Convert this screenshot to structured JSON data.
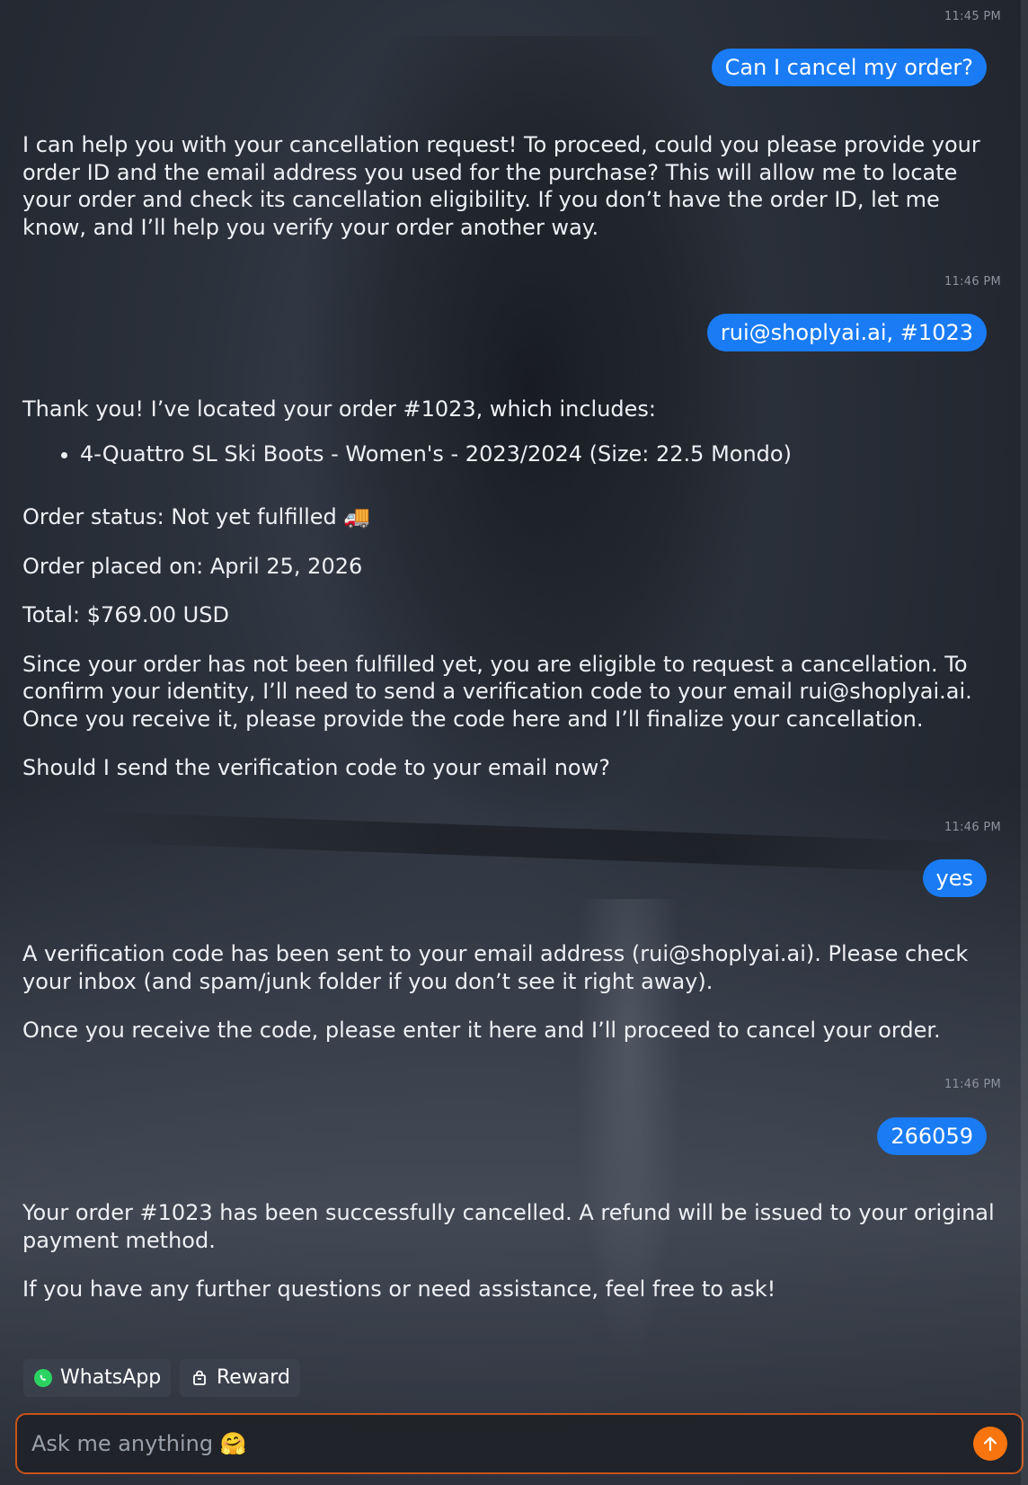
{
  "conversation": {
    "messages": [
      {
        "role": "user",
        "time": "11:45 PM",
        "text": "Can I cancel my order?"
      },
      {
        "role": "assistant",
        "paragraphs": [
          "I can help you with your cancellation request! To proceed, could you please provide your order ID and the email address you used for the purchase? This will allow me to locate your order and check its cancellation eligibility. If you don’t have the order ID, let me know, and I’ll help you verify your order another way."
        ]
      },
      {
        "role": "user",
        "time": "11:46 PM",
        "text": "rui@shoplyai.ai, #1023"
      },
      {
        "role": "assistant",
        "intro": "Thank you! I’ve located your order #1023, which includes:",
        "items": [
          "4-Quattro SL Ski Boots - Women's - 2023/2024 (Size: 22.5 Mondo)"
        ],
        "status_label": "Order status:",
        "status_value": "Not yet fulfilled 🚚",
        "placed_label": "Order placed on:",
        "placed_value": "April 25, 2026",
        "total_label": "Total:",
        "total_value": "$769.00 USD",
        "paragraphs": [
          "Since your order has not been fulfilled yet, you are eligible to request a cancellation. To confirm your identity, I’ll need to send a verification code to your email rui@shoplyai.ai. Once you receive it, please provide the code here and I’ll finalize your cancellation.",
          "Should I send the verification code to your email now?"
        ]
      },
      {
        "role": "user",
        "time": "11:46 PM",
        "text": "yes"
      },
      {
        "role": "assistant",
        "paragraphs": [
          "A verification code has been sent to your email address (rui@shoplyai.ai). Please check your inbox (and spam/junk folder if you don’t see it right away).",
          "Once you receive the code, please enter it here and I’ll proceed to cancel your order."
        ]
      },
      {
        "role": "user",
        "time": "11:46 PM",
        "text": "266059"
      },
      {
        "role": "assistant",
        "paragraphs": [
          "Your order #1023 has been successfully cancelled. A refund will be issued to your original payment method.",
          "If you have any further questions or need assistance, feel free to ask!"
        ]
      }
    ]
  },
  "quick_actions": {
    "whatsapp": {
      "label": "WhatsApp",
      "icon": "whatsapp-icon"
    },
    "reward": {
      "label": "Reward",
      "icon": "gift-bag-icon"
    }
  },
  "composer": {
    "placeholder": "Ask me anything 🤗",
    "send_icon": "arrow-up-icon"
  },
  "colors": {
    "user_bubble": "#1a7cf5",
    "send_button": "#f7740f",
    "composer_border": "#c8531a",
    "whatsapp": "#2bd462"
  }
}
